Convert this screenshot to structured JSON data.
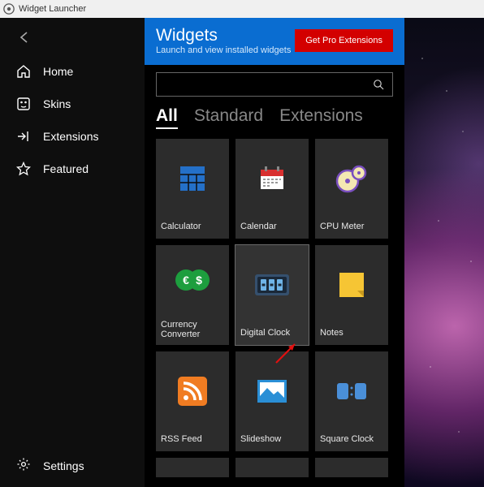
{
  "titlebar": {
    "app_name": "Widget Launcher"
  },
  "sidebar": {
    "items": [
      {
        "label": "Home"
      },
      {
        "label": "Skins"
      },
      {
        "label": "Extensions"
      },
      {
        "label": "Featured"
      }
    ],
    "settings": "Settings"
  },
  "header": {
    "title": "Widgets",
    "subtitle": "Launch and view installed widgets",
    "pro_button": "Get Pro Extensions"
  },
  "search": {
    "placeholder": ""
  },
  "tabs": [
    {
      "label": "All",
      "active": true
    },
    {
      "label": "Standard",
      "active": false
    },
    {
      "label": "Extensions",
      "active": false
    }
  ],
  "widgets": [
    {
      "label": "Calculator"
    },
    {
      "label": "Calendar"
    },
    {
      "label": "CPU Meter"
    },
    {
      "label": "Currency Converter"
    },
    {
      "label": "Digital Clock"
    },
    {
      "label": "Notes"
    },
    {
      "label": "RSS Feed"
    },
    {
      "label": "Slideshow"
    },
    {
      "label": "Square Clock"
    }
  ],
  "colors": {
    "accent": "#0a6dd1",
    "danger": "#d30000",
    "tile": "#2c2c2c"
  }
}
